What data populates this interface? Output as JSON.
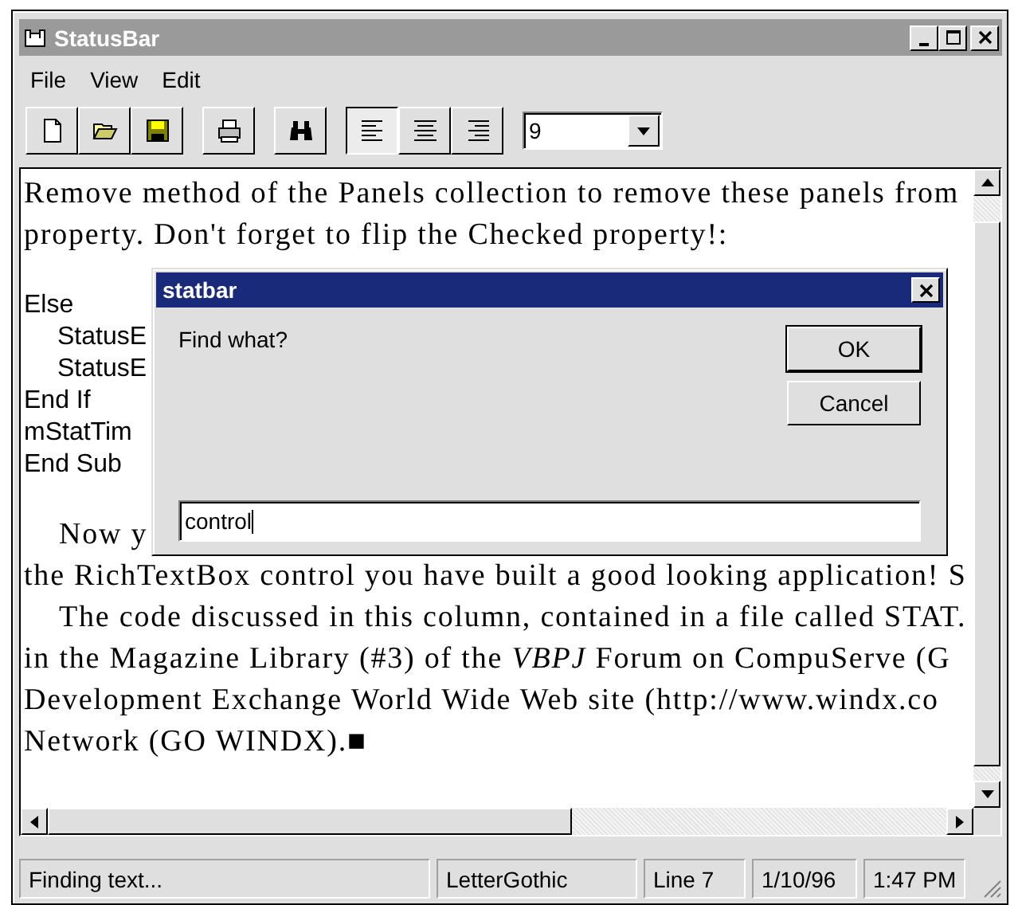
{
  "window": {
    "title": "StatusBar",
    "active": false
  },
  "menu": [
    "File",
    "View",
    "Edit"
  ],
  "toolbar": [
    {
      "kind": "new"
    },
    {
      "kind": "open"
    },
    {
      "kind": "save"
    },
    {
      "kind": "gap"
    },
    {
      "kind": "print"
    },
    {
      "kind": "gap"
    },
    {
      "kind": "find"
    },
    {
      "kind": "gap"
    },
    {
      "kind": "align_left",
      "selected": true
    },
    {
      "kind": "align_center",
      "selected": false
    },
    {
      "kind": "align_right",
      "selected": false
    },
    {
      "kind": "gap"
    }
  ],
  "font_size_combo": {
    "value": "9"
  },
  "document": [
    {
      "kind": "prose",
      "text": "Remove method of the Panels collection to remove these panels from"
    },
    {
      "kind": "prose",
      "text": "property. Don't forget to flip the Checked property!:"
    },
    {
      "kind": "blank"
    },
    {
      "kind": "code",
      "text": "Else"
    },
    {
      "kind": "code_indent",
      "text": "StatusE"
    },
    {
      "kind": "code_indent",
      "text": "StatusE"
    },
    {
      "kind": "code",
      "text": "End If"
    },
    {
      "kind": "code",
      "text": "mStatTim"
    },
    {
      "kind": "code",
      "text": "End Sub"
    },
    {
      "kind": "blank"
    },
    {
      "kind": "prose_indent",
      "text": "Now y"
    },
    {
      "kind": "prose",
      "text": "the RichTextBox control you have built a good looking application! S"
    },
    {
      "kind": "prose_indent",
      "text": "The code discussed in this column, contained in a file called STAT."
    },
    {
      "kind": "prose",
      "text": "in the Magazine Library (#3) of the *VBPJ* Forum on CompuServe (G"
    },
    {
      "kind": "prose",
      "text": "Development Exchange World Wide Web site (http://www.windx.co"
    },
    {
      "kind": "prose",
      "text": "Network (GO WINDX).■"
    }
  ],
  "dialog": {
    "title": "statbar",
    "prompt": "Find what?",
    "value": "control",
    "buttons": [
      {
        "label": "OK",
        "default": true
      },
      {
        "label": "Cancel",
        "default": false
      }
    ]
  },
  "status_bar": [
    "Finding text...",
    "LetterGothic",
    "Line 7",
    "1/10/96",
    "1:47 PM"
  ]
}
